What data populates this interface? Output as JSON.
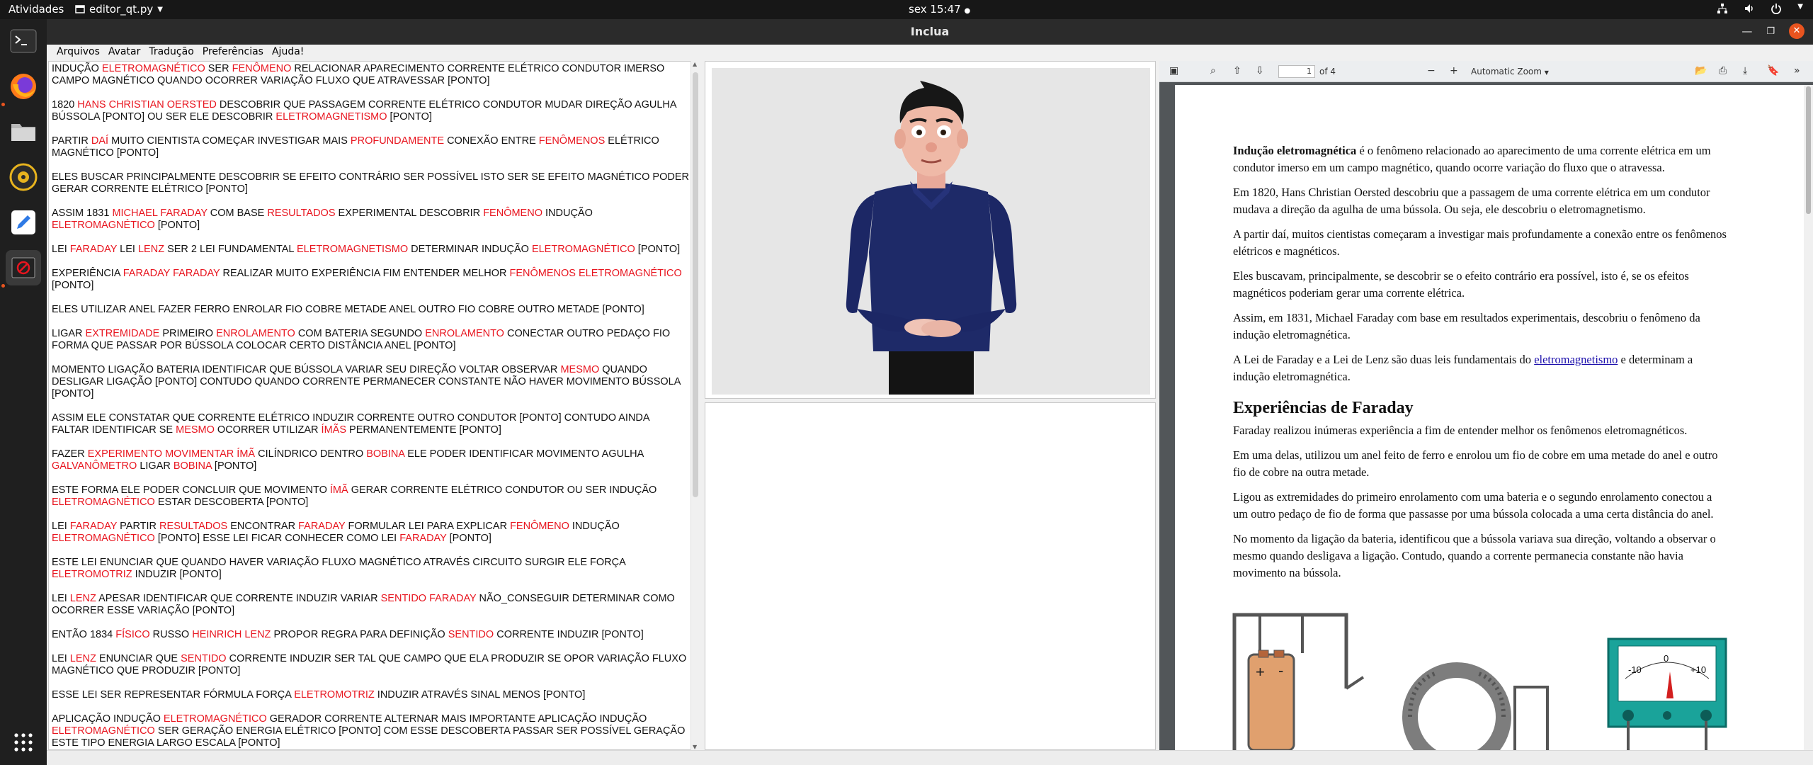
{
  "system": {
    "activities": "Atividades",
    "app_name": "editor_qt.py",
    "clock": "sex 15:47"
  },
  "window": {
    "title": "Inclua"
  },
  "menu": [
    "Arquivos",
    "Avatar",
    "Tradução",
    "Preferências",
    "Ajuda!"
  ],
  "gloss": [
    [
      [
        "INDUÇÃO ",
        0
      ],
      [
        "ELETROMAGNÉTICO",
        1
      ],
      [
        " SER ",
        0
      ],
      [
        "FENÔMENO",
        1
      ],
      [
        " RELACIONAR APARECIMENTO CORRENTE ELÉTRICO CONDUTOR IMERSO CAMPO MAGNÉTICO QUANDO OCORRER VARIAÇÃO FLUXO QUE ATRAVESSAR [PONTO]",
        0
      ]
    ],
    [
      [
        "1820 ",
        0
      ],
      [
        "HANS CHRISTIAN OERSTED",
        1
      ],
      [
        " DESCOBRIR QUE PASSAGEM CORRENTE ELÉTRICO CONDUTOR MUDAR DIREÇÃO AGULHA BÚSSOLA [PONTO] OU SER ELE DESCOBRIR ",
        0
      ],
      [
        "ELETROMAGNETISMO",
        1
      ],
      [
        " [PONTO]",
        0
      ]
    ],
    [
      [
        "PARTIR ",
        0
      ],
      [
        "DAÍ",
        1
      ],
      [
        " MUITO CIENTISTA COMEÇAR INVESTIGAR MAIS ",
        0
      ],
      [
        "PROFUNDAMENTE",
        1
      ],
      [
        " CONEXÃO ENTRE ",
        0
      ],
      [
        "FENÔMENOS",
        1
      ],
      [
        " ELÉTRICO MAGNÉTICO [PONTO]",
        0
      ]
    ],
    [
      [
        "ELES BUSCAR PRINCIPALMENTE DESCOBRIR SE EFEITO CONTRÁRIO SER POSSÍVEL ISTO SER SE EFEITO MAGNÉTICO PODER GERAR CORRENTE ELÉTRICO [PONTO]",
        0
      ]
    ],
    [
      [
        "ASSIM 1831 ",
        0
      ],
      [
        "MICHAEL FARADAY",
        1
      ],
      [
        " COM BASE ",
        0
      ],
      [
        "RESULTADOS",
        1
      ],
      [
        " EXPERIMENTAL DESCOBRIR ",
        0
      ],
      [
        "FENÔMENO",
        1
      ],
      [
        " INDUÇÃO ",
        0
      ],
      [
        "ELETROMAGNÉTICO",
        1
      ],
      [
        " [PONTO]",
        0
      ]
    ],
    [
      [
        "LEI ",
        0
      ],
      [
        "FARADAY",
        1
      ],
      [
        " LEI ",
        0
      ],
      [
        "LENZ",
        1
      ],
      [
        " SER 2 LEI FUNDAMENTAL ",
        0
      ],
      [
        "ELETROMAGNETISMO",
        1
      ],
      [
        " DETERMINAR INDUÇÃO ",
        0
      ],
      [
        "ELETROMAGNÉTICO",
        1
      ],
      [
        " [PONTO]",
        0
      ]
    ],
    [
      [
        "EXPERIÊNCIA ",
        0
      ],
      [
        "FARADAY FARADAY",
        1
      ],
      [
        " REALIZAR MUITO EXPERIÊNCIA FIM ENTENDER MELHOR ",
        0
      ],
      [
        "FENÔMENOS ELETROMAGNÉTICO",
        1
      ],
      [
        " [PONTO]",
        0
      ]
    ],
    [
      [
        "ELES UTILIZAR ANEL FAZER FERRO ENROLAR FIO COBRE METADE ANEL OUTRO FIO COBRE OUTRO METADE [PONTO]",
        0
      ]
    ],
    [
      [
        "LIGAR ",
        0
      ],
      [
        "EXTREMIDADE",
        1
      ],
      [
        " PRIMEIRO ",
        0
      ],
      [
        "ENROLAMENTO",
        1
      ],
      [
        " COM BATERIA SEGUNDO ",
        0
      ],
      [
        "ENROLAMENTO",
        1
      ],
      [
        " CONECTAR OUTRO PEDAÇO FIO FORMA QUE PASSAR POR BÚSSOLA COLOCAR CERTO DISTÂNCIA ANEL [PONTO]",
        0
      ]
    ],
    [
      [
        "MOMENTO LIGAÇÃO BATERIA IDENTIFICAR QUE BÚSSOLA VARIAR SEU DIREÇÃO VOLTAR OBSERVAR ",
        0
      ],
      [
        "MESMO",
        1
      ],
      [
        " QUANDO DESLIGAR LIGAÇÃO [PONTO] CONTUDO QUANDO CORRENTE PERMANECER CONSTANTE NÃO HAVER MOVIMENTO BÚSSOLA [PONTO]",
        0
      ]
    ],
    [
      [
        "ASSIM ELE CONSTATAR QUE CORRENTE ELÉTRICO INDUZIR CORRENTE OUTRO CONDUTOR [PONTO] CONTUDO AINDA FALTAR IDENTIFICAR SE ",
        0
      ],
      [
        "MESMO",
        1
      ],
      [
        " OCORRER UTILIZAR ",
        0
      ],
      [
        "ÍMÃS",
        1
      ],
      [
        " PERMANENTEMENTE [PONTO]",
        0
      ]
    ],
    [
      [
        "FAZER ",
        0
      ],
      [
        "EXPERIMENTO MOVIMENTAR ÍMÃ",
        1
      ],
      [
        " CILÍNDRICO DENTRO ",
        0
      ],
      [
        "BOBINA",
        1
      ],
      [
        " ELE PODER IDENTIFICAR MOVIMENTO AGULHA ",
        0
      ],
      [
        "GALVANÔMETRO",
        1
      ],
      [
        " LIGAR ",
        0
      ],
      [
        "BOBINA",
        1
      ],
      [
        " [PONTO]",
        0
      ]
    ],
    [
      [
        "ESTE FORMA ELE PODER CONCLUIR QUE MOVIMENTO ",
        0
      ],
      [
        "ÍMÃ",
        1
      ],
      [
        " GERAR CORRENTE ELÉTRICO CONDUTOR OU SER INDUÇÃO ",
        0
      ],
      [
        "ELETROMAGNÉTICO",
        1
      ],
      [
        " ESTAR DESCOBERTA [PONTO]",
        0
      ]
    ],
    [
      [
        "LEI ",
        0
      ],
      [
        "FARADAY",
        1
      ],
      [
        " PARTIR ",
        0
      ],
      [
        "RESULTADOS",
        1
      ],
      [
        " ENCONTRAR ",
        0
      ],
      [
        "FARADAY",
        1
      ],
      [
        " FORMULAR LEI PARA EXPLICAR ",
        0
      ],
      [
        "FENÔMENO",
        1
      ],
      [
        " INDUÇÃO ",
        0
      ],
      [
        "ELETROMAGNÉTICO",
        1
      ],
      [
        " [PONTO] ESSE LEI FICAR CONHECER COMO LEI ",
        0
      ],
      [
        "FARADAY",
        1
      ],
      [
        " [PONTO]",
        0
      ]
    ],
    [
      [
        "ESTE LEI ENUNCIAR QUE QUANDO HAVER VARIAÇÃO FLUXO MAGNÉTICO ATRAVÉS CIRCUITO SURGIR ELE FORÇA ",
        0
      ],
      [
        "ELETROMOTRIZ",
        1
      ],
      [
        " INDUZIR [PONTO]",
        0
      ]
    ],
    [
      [
        "LEI ",
        0
      ],
      [
        "LENZ",
        1
      ],
      [
        " APESAR IDENTIFICAR QUE CORRENTE INDUZIR VARIAR ",
        0
      ],
      [
        "SENTIDO FARADAY",
        1
      ],
      [
        " NÃO_CONSEGUIR DETERMINAR COMO OCORRER ESSE VARIAÇÃO [PONTO]",
        0
      ]
    ],
    [
      [
        "ENTÃO 1834 ",
        0
      ],
      [
        "FÍSICO",
        1
      ],
      [
        " RUSSO ",
        0
      ],
      [
        "HEINRICH LENZ",
        1
      ],
      [
        " PROPOR REGRA PARA DEFINIÇÃO ",
        0
      ],
      [
        "SENTIDO",
        1
      ],
      [
        " CORRENTE INDUZIR [PONTO]",
        0
      ]
    ],
    [
      [
        "LEI ",
        0
      ],
      [
        "LENZ",
        1
      ],
      [
        " ENUNCIAR QUE ",
        0
      ],
      [
        "SENTIDO",
        1
      ],
      [
        " CORRENTE INDUZIR SER TAL QUE CAMPO QUE ELA PRODUZIR SE OPOR VARIAÇÃO FLUXO MAGNÉTICO QUE PRODUZIR [PONTO]",
        0
      ]
    ],
    [
      [
        "ESSE LEI SER REPRESENTAR FÓRMULA FORÇA ",
        0
      ],
      [
        "ELETROMOTRIZ",
        1
      ],
      [
        " INDUZIR ATRAVÉS SINAL MENOS [PONTO]",
        0
      ]
    ],
    [
      [
        "APLICAÇÃO INDUÇÃO ",
        0
      ],
      [
        "ELETROMAGNÉTICO",
        1
      ],
      [
        " GERADOR CORRENTE ALTERNAR MAIS IMPORTANTE APLICAÇÃO INDUÇÃO ",
        0
      ],
      [
        "ELETROMAGNÉTICO",
        1
      ],
      [
        " SER GERAÇÃO ENERGIA ELÉTRICO [PONTO] COM ESSE DESCOBERTA PASSAR SER POSSÍVEL GERAÇÃO ESTE TIPO ENERGIA LARGO ESCALA [PONTO]",
        0
      ]
    ]
  ],
  "pdf": {
    "page_number": "1",
    "of_pages": "of 4",
    "zoom": "Automatic Zoom",
    "doc": {
      "p1_bold": "Indução eletromagnética",
      "p1_rest": " é o fenômeno relacionado ao aparecimento de uma corrente elétrica em um condutor imerso em um campo magnético, quando ocorre variação do fluxo que o atravessa.",
      "p2": "Em 1820, Hans Christian Oersted descobriu que a passagem de uma corrente elétrica em um condutor mudava a direção da agulha de uma bússola. Ou seja, ele descobriu o eletromagnetismo.",
      "p3": "A partir daí, muitos cientistas começaram a investigar mais profundamente a conexão entre os fenômenos elétricos e magnéticos.",
      "p4": "Eles buscavam, principalmente, se descobrir se o efeito contrário era possível, isto é, se os efeitos magnéticos poderiam gerar uma corrente elétrica.",
      "p5": "Assim, em 1831, Michael Faraday com base em resultados experimentais, descobriu o fenômeno da indução eletromagnética.",
      "p6_a": "A Lei de Faraday e a Lei de Lenz são duas leis fundamentais do ",
      "p6_link": "eletromagnetismo",
      "p6_b": " e determinam a indução eletromagnética.",
      "h2": "Experiências de Faraday",
      "p7": "Faraday realizou inúmeras experiência a fim de entender melhor os fenômenos eletromagnéticos.",
      "p8": "Em uma delas, utilizou um anel feito de ferro e enrolou um fio de cobre em uma metade do anel e outro fio de cobre na outra metade.",
      "p9": "Ligou as extremidades do primeiro enrolamento com uma bateria e o segundo enrolamento conectou a um outro pedaço de fio de forma que passasse por uma bússola colocada a uma certa distância do anel.",
      "p10": "No momento da ligação da bateria, identificou que a bússola variava sua direção, voltando a observar o mesmo quando desligava a ligação. Contudo, quando a corrente permanecia constante não havia movimento na bússola.",
      "fig_plus": "+",
      "fig_minus": "-",
      "fig_m10": "-10",
      "fig_0": "0",
      "fig_p10": "+10"
    }
  },
  "colors": {
    "highlight": "#e8151f",
    "accent": "#e9541f"
  }
}
